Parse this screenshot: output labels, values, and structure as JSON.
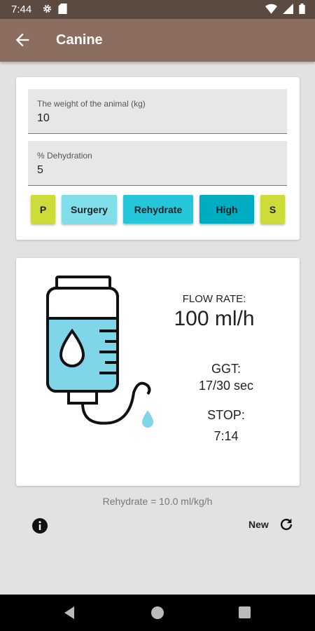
{
  "status_bar": {
    "time": "7:44",
    "icons": [
      "gear-icon",
      "sd-card-icon",
      "wifi-icon",
      "signal-icon",
      "battery-icon"
    ]
  },
  "app_bar": {
    "title": "Canine",
    "back_icon": "arrow-back-icon",
    "background": "#8b6e60"
  },
  "inputs": {
    "weight": {
      "label": "The weight of the animal (kg)",
      "value": "10"
    },
    "dehydration": {
      "label": "% Dehydration",
      "value": "5"
    }
  },
  "options": [
    {
      "label": "P",
      "color": "#cddc39"
    },
    {
      "label": "Surgery",
      "color": "#80deea"
    },
    {
      "label": "Rehydrate",
      "color": "#26c6da"
    },
    {
      "label": "High",
      "color": "#00acc1"
    },
    {
      "label": "S",
      "color": "#cddc39"
    }
  ],
  "result": {
    "illustration": "iv-bag-icon",
    "flow_rate_label": "FLOW RATE:",
    "flow_rate_value": "100 ml/h",
    "ggt_label": "GGT:",
    "ggt_value": "17/30 sec",
    "stop_label": "STOP:",
    "stop_value": "7:14"
  },
  "footer": {
    "rehydrate_rate": "Rehydrate = 10.0 ml/kg/h",
    "new_label": "New",
    "info_icon": "info-icon",
    "refresh_icon": "refresh-icon"
  },
  "nav_bar": {
    "icons": [
      "nav-back-icon",
      "nav-home-icon",
      "nav-recent-icon"
    ]
  }
}
